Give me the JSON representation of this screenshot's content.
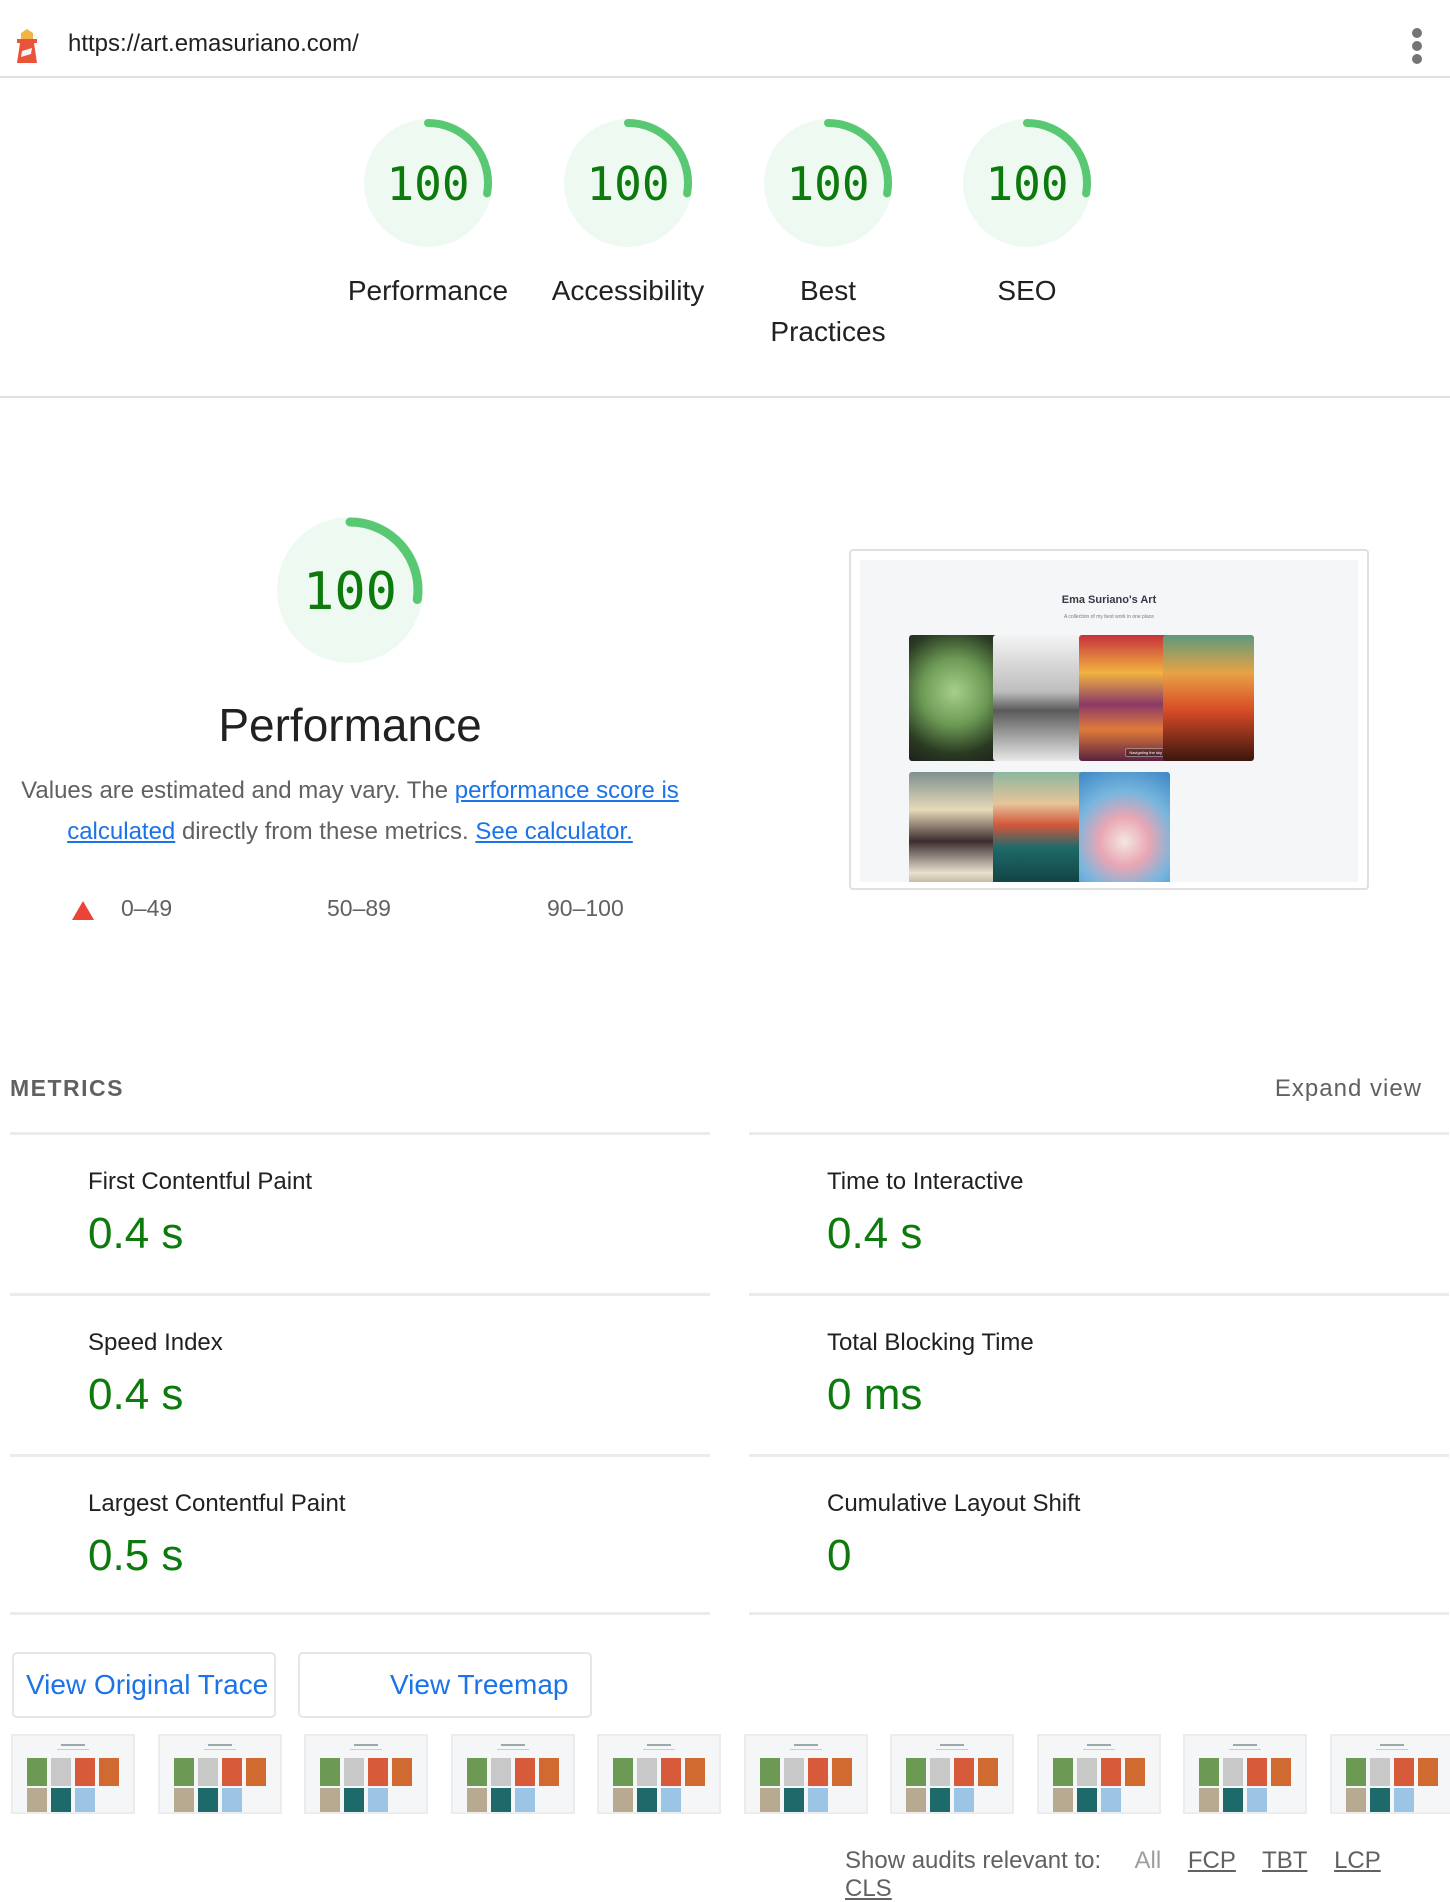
{
  "topbar": {
    "url": "https://art.emasuriano.com/",
    "logo_icon": "lighthouse-icon",
    "menu_icon": "more-vertical-icon"
  },
  "colors": {
    "pass": "#0c7a0c",
    "gauge_arc": "#59c872",
    "gauge_bg": "#eef9f1",
    "fail": "#eb4335",
    "link": "#1a73e8"
  },
  "summary_gauges": [
    {
      "label": "Performance",
      "score": 100
    },
    {
      "label": "Accessibility",
      "score": 100
    },
    {
      "label": "Best Practices",
      "label_line1": "Best",
      "label_line2": "Practices",
      "score": 100
    },
    {
      "label": "SEO",
      "score": 100
    }
  ],
  "performance": {
    "score": 100,
    "title": "Performance",
    "desc_prefix": "Values are estimated and may vary. The ",
    "desc_link1": "performance score is calculated",
    "desc_middle": " directly from these metrics. ",
    "desc_link2": "See calculator.",
    "legend": [
      {
        "range": "0–49",
        "icon": "fail-triangle-icon"
      },
      {
        "range": "50–89",
        "icon": ""
      },
      {
        "range": "90–100",
        "icon": ""
      }
    ]
  },
  "preview": {
    "title": "Ema Suriano's Art",
    "subtitle": "A collection of my best work in one place",
    "visible_caption": "Navigating the sky"
  },
  "metrics": {
    "header": "METRICS",
    "expand_label": "Expand view",
    "left": [
      {
        "label": "First Contentful Paint",
        "value": "0.4 s"
      },
      {
        "label": "Speed Index",
        "value": "0.4 s"
      },
      {
        "label": "Largest Contentful Paint",
        "value": "0.5 s"
      }
    ],
    "right": [
      {
        "label": "Time to Interactive",
        "value": "0.4 s"
      },
      {
        "label": "Total Blocking Time",
        "value": "0 ms"
      },
      {
        "label": "Cumulative Layout Shift",
        "value": "0"
      }
    ]
  },
  "buttons": {
    "trace": "View Original Trace",
    "treemap": "View Treemap"
  },
  "filmstrip": {
    "frame_count": 10
  },
  "filter": {
    "label": "Show audits relevant to:",
    "options": [
      "All",
      "FCP",
      "TBT",
      "LCP",
      "CLS"
    ]
  }
}
